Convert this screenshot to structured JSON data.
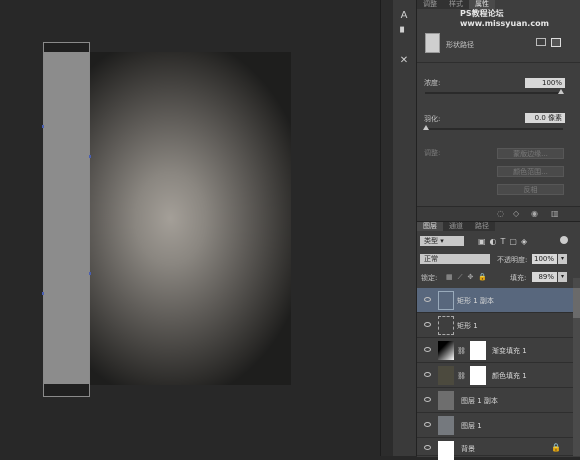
{
  "tool_icons": [
    "text-tool-icon",
    "note-icon",
    "crossed-tools-icon"
  ],
  "properties": {
    "tabs": [
      "调整",
      "样式",
      "属性"
    ],
    "type_label": "形状路径",
    "density_label": "浓度:",
    "density_value": "100%",
    "feather_label": "羽化:",
    "feather_value": "0.0 像素",
    "refine_label": "调整:",
    "buttons": [
      "蒙版边缘...",
      "颜色范围...",
      "反相"
    ]
  },
  "layers": {
    "tabs": [
      "图层",
      "通道",
      "路径"
    ],
    "filter_kind": "类型",
    "blend_mode": "正常",
    "opacity_label": "不透明度:",
    "opacity_value": "100%",
    "lock_label": "锁定:",
    "fill_label": "填充:",
    "fill_value": "89%",
    "items": [
      {
        "name": "矩形 1 副本",
        "selected": true
      },
      {
        "name": "矩形 1",
        "selected": false
      },
      {
        "name": "渐变填充 1",
        "selected": false
      },
      {
        "name": "颜色填充 1",
        "selected": false
      },
      {
        "name": "图层 1 副本",
        "selected": false
      },
      {
        "name": "图层 1",
        "selected": false
      },
      {
        "name": "背景",
        "selected": false
      }
    ]
  },
  "watermark": "PS教程论坛 www.missyuan.com",
  "colors": {
    "selection": "#58677d",
    "panel": "#3e3e3e",
    "path_handle": "#4a5fb0"
  }
}
